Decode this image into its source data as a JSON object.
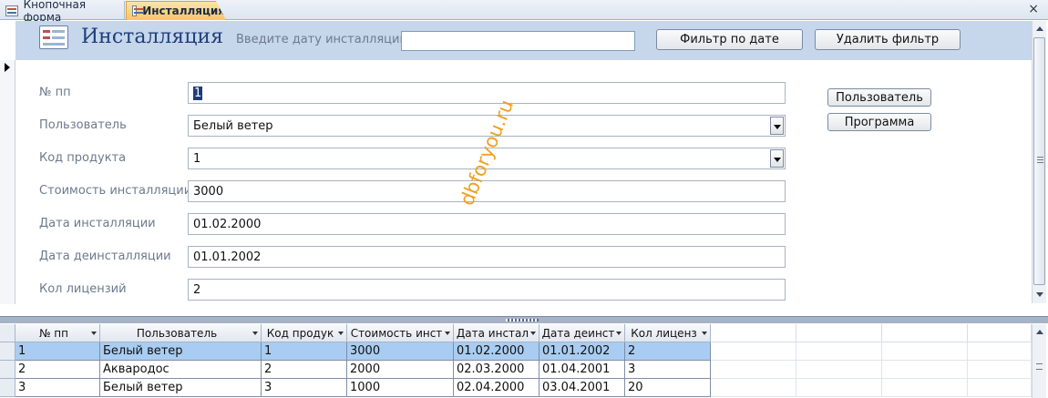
{
  "tabs": [
    {
      "label": "Кнопочная форма",
      "active": false
    },
    {
      "label": "Инсталляция",
      "active": true
    }
  ],
  "header": {
    "title": "Инсталляция",
    "filter_label": "Введите дату инсталляции",
    "filter_value": "",
    "filter_button": "Фильтр по дате",
    "remove_filter_button": "Удалить фильтр"
  },
  "form": {
    "fields": [
      {
        "label": "№ пп",
        "value": "1"
      },
      {
        "label": "Пользователь",
        "value": "Белый ветер"
      },
      {
        "label": "Код продукта",
        "value": "1"
      },
      {
        "label": "Стоимость инсталляции",
        "value": "3000"
      },
      {
        "label": "Дата инсталляции",
        "value": "01.02.2000"
      },
      {
        "label": "Дата деинсталляции",
        "value": "01.01.2002"
      },
      {
        "label": "Кол лицензий",
        "value": "2"
      }
    ],
    "user_button": "Пользователь",
    "program_button": "Программа"
  },
  "watermark": "dbforyou.ru",
  "datasheet": {
    "columns": [
      "№ пп",
      "Пользователь",
      "Код продук",
      "Стоимость инст",
      "Дата инстал",
      "Дата деинст",
      "Кол лиценз"
    ],
    "rows": [
      [
        "1",
        "Белый ветер",
        "1",
        "3000",
        "01.02.2000",
        "01.01.2002",
        "2"
      ],
      [
        "2",
        "Аквародос",
        "2",
        "2000",
        "02.03.2000",
        "01.04.2001",
        "3"
      ],
      [
        "3",
        "Белый ветер",
        "3",
        "1000",
        "02.04.2000",
        "03.04.2001",
        "20"
      ]
    ],
    "current_row": 0
  },
  "colors": {
    "header_bg": "#c6d6eb",
    "active_tab": "#f7c56a",
    "title_color": "#1f3f7a",
    "selected_row": "#a9cdf2",
    "watermark": "#f0a020"
  }
}
